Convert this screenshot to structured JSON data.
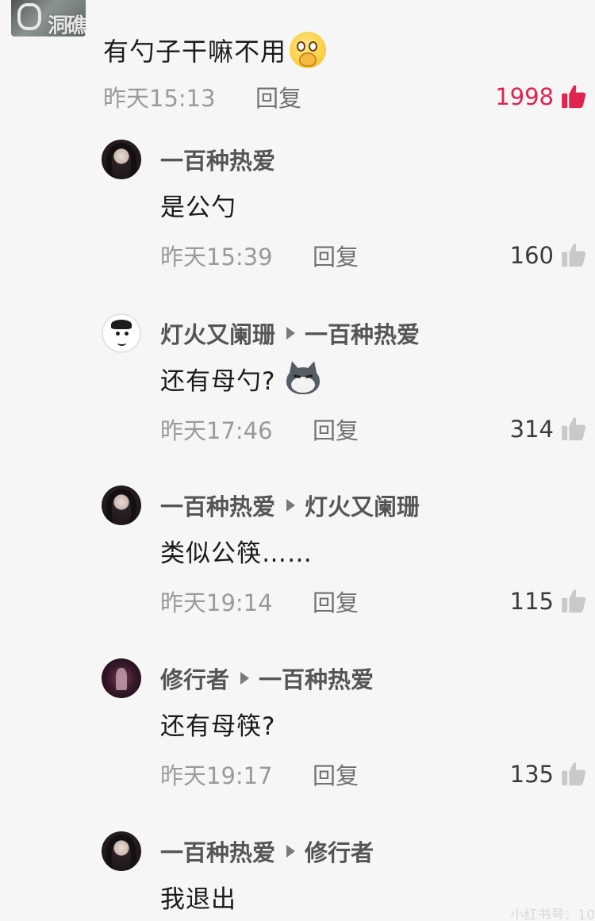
{
  "top_comment": {
    "watermark": "洞礁",
    "author_partial": "",
    "text": "有勺子干嘛不用",
    "emoji": "pleading-hands-emoji",
    "time": "昨天15:13",
    "reply_label": "回复",
    "likes": "1998",
    "liked": true,
    "like_color": "#e0234f"
  },
  "replies": [
    {
      "author": "一百种热爱",
      "reply_to": "",
      "text": "是公勺",
      "time": "昨天15:39",
      "reply_label": "回复",
      "likes": "160"
    },
    {
      "author": "灯火又阑珊",
      "reply_to": "一百种热爱",
      "text": "还有母勺?",
      "emoji": "husky-cat-emoji",
      "time": "昨天17:46",
      "reply_label": "回复",
      "likes": "314"
    },
    {
      "author": "一百种热爱",
      "reply_to": "灯火又阑珊",
      "text": "类似公筷……",
      "time": "昨天19:14",
      "reply_label": "回复",
      "likes": "115"
    },
    {
      "author": "修行者",
      "reply_to": "一百种热爱",
      "text": "还有母筷?",
      "time": "昨天19:17",
      "reply_label": "回复",
      "likes": "135"
    },
    {
      "author": "一百种热爱",
      "reply_to": "修行者",
      "text": "我退出",
      "time": "",
      "reply_label": "",
      "likes": ""
    }
  ],
  "bottom_watermark": "小红书号：10",
  "colors": {
    "background": "#f6f6f6",
    "meta_text": "#9a9a9a",
    "liked_red": "#e0234f",
    "thumb_gray": "#c9c9c9"
  }
}
